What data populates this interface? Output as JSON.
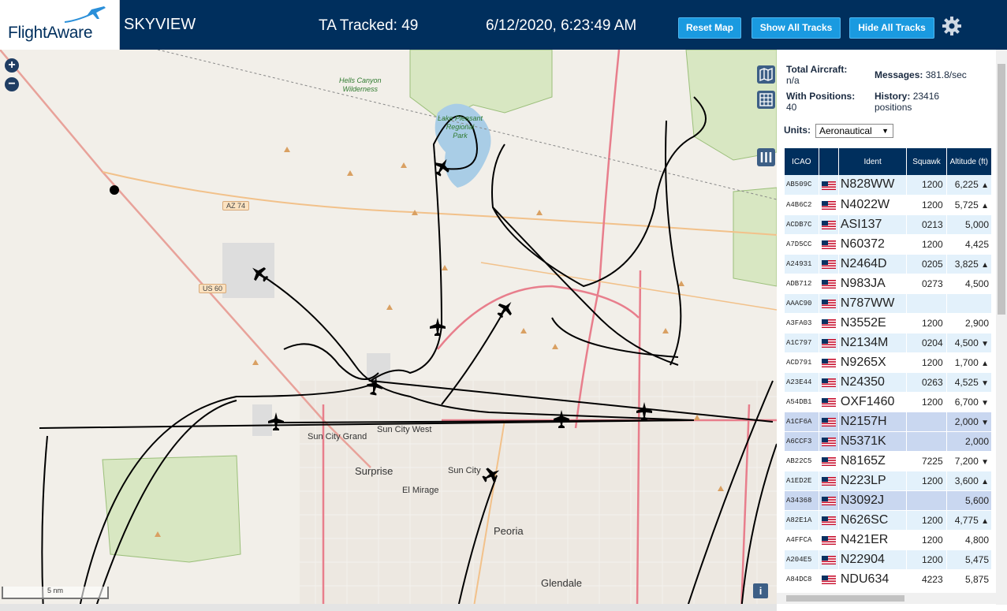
{
  "header": {
    "logo": "FlightAware",
    "title": "SKYVIEW",
    "tracked": "TA Tracked: 49",
    "datetime": "6/12/2020, 6:23:49 AM",
    "buttons": {
      "reset_map": "Reset Map",
      "show_all": "Show All Tracks",
      "hide_all": "Hide All Tracks"
    },
    "settings_icon": "gear-icon"
  },
  "map": {
    "zoom_in": "+",
    "zoom_out": "−",
    "scale": "5 nm",
    "info": "i",
    "labels": {
      "hells_canyon": "Hells Canyon",
      "wilderness": "Wilderness",
      "lake_pleasant_1": "Lake Pleasant",
      "lake_pleasant_2": "Regional",
      "lake_pleasant_3": "Park",
      "az74": "AZ 74",
      "us60": "US 60",
      "sun_city_grand": "Sun City Grand",
      "sun_city_west": "Sun City West",
      "surprise": "Surprise",
      "sun_city": "Sun City",
      "el_mirage": "El Mirage",
      "peoria": "Peoria",
      "glendale": "Glendale"
    }
  },
  "panel": {
    "total_aircraft_label": "Total Aircraft:",
    "total_aircraft_value": "n/a",
    "with_positions_label": "With Positions:",
    "with_positions_value": "40",
    "messages_label": "Messages:",
    "messages_value": "381.8/sec",
    "history_label": "History:",
    "history_value": "23416",
    "history_unit": "positions",
    "units_label": "Units:",
    "units_value": "Aeronautical",
    "columns": [
      "ICAO",
      "",
      "Ident",
      "Squawk",
      "Altitude (ft)"
    ],
    "rows": [
      {
        "icao": "AB509C",
        "ident": "N828WW",
        "squawk": "1200",
        "alt": "6,225",
        "trend": "▲",
        "style": "even"
      },
      {
        "icao": "A4B6C2",
        "ident": "N4022W",
        "squawk": "1200",
        "alt": "5,725",
        "trend": "▲",
        "style": "odd"
      },
      {
        "icao": "ACDB7C",
        "ident": "ASI137",
        "squawk": "0213",
        "alt": "5,000",
        "trend": "",
        "style": "even"
      },
      {
        "icao": "A7D5CC",
        "ident": "N60372",
        "squawk": "1200",
        "alt": "4,425",
        "trend": "",
        "style": "odd"
      },
      {
        "icao": "A24931",
        "ident": "N2464D",
        "squawk": "0205",
        "alt": "3,825",
        "trend": "▲",
        "style": "even"
      },
      {
        "icao": "ADB712",
        "ident": "N983JA",
        "squawk": "0273",
        "alt": "4,500",
        "trend": "",
        "style": "odd"
      },
      {
        "icao": "AAAC90",
        "ident": "N787WW",
        "squawk": "",
        "alt": "",
        "trend": "",
        "style": "even"
      },
      {
        "icao": "A3FA03",
        "ident": "N3552E",
        "squawk": "1200",
        "alt": "2,900",
        "trend": "",
        "style": "odd"
      },
      {
        "icao": "A1C797",
        "ident": "N2134M",
        "squawk": "0204",
        "alt": "4,500",
        "trend": "▼",
        "style": "even"
      },
      {
        "icao": "ACD791",
        "ident": "N9265X",
        "squawk": "1200",
        "alt": "1,700",
        "trend": "▲",
        "style": "odd"
      },
      {
        "icao": "A23E44",
        "ident": "N24350",
        "squawk": "0263",
        "alt": "4,525",
        "trend": "▼",
        "style": "even"
      },
      {
        "icao": "A54DB1",
        "ident": "OXF1460",
        "squawk": "1200",
        "alt": "6,700",
        "trend": "▼",
        "style": "odd"
      },
      {
        "icao": "A1CF6A",
        "ident": "N2157H",
        "squawk": "",
        "alt": "2,000",
        "trend": "▼",
        "style": "sel"
      },
      {
        "icao": "A6CCF3",
        "ident": "N5371K",
        "squawk": "",
        "alt": "2,000",
        "trend": "",
        "style": "sel"
      },
      {
        "icao": "AB22C5",
        "ident": "N8165Z",
        "squawk": "7225",
        "alt": "7,200",
        "trend": "▼",
        "style": "odd"
      },
      {
        "icao": "A1ED2E",
        "ident": "N223LP",
        "squawk": "1200",
        "alt": "3,600",
        "trend": "▲",
        "style": "even"
      },
      {
        "icao": "A34368",
        "ident": "N3092J",
        "squawk": "",
        "alt": "5,600",
        "trend": "",
        "style": "sel"
      },
      {
        "icao": "A82E1A",
        "ident": "N626SC",
        "squawk": "1200",
        "alt": "4,775",
        "trend": "▲",
        "style": "even"
      },
      {
        "icao": "A4FFCA",
        "ident": "N421ER",
        "squawk": "1200",
        "alt": "4,800",
        "trend": "",
        "style": "odd"
      },
      {
        "icao": "A204E5",
        "ident": "N22904",
        "squawk": "1200",
        "alt": "5,475",
        "trend": "",
        "style": "even"
      },
      {
        "icao": "A84DC8",
        "ident": "NDU634",
        "squawk": "4223",
        "alt": "5,875",
        "trend": "",
        "style": "odd"
      }
    ]
  }
}
